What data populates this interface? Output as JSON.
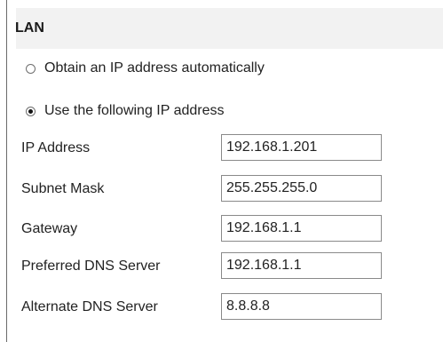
{
  "section": {
    "title": "LAN"
  },
  "ip_mode": {
    "options": [
      {
        "label": "Obtain an IP address automatically",
        "selected": false
      },
      {
        "label": "Use the following IP address",
        "selected": true
      }
    ]
  },
  "fields": {
    "ip_address": {
      "label": "IP Address",
      "value": "192.168.1.201"
    },
    "subnet_mask": {
      "label": "Subnet Mask",
      "value": "255.255.255.0"
    },
    "gateway": {
      "label": "Gateway",
      "value": "192.168.1.1"
    },
    "preferred_dns": {
      "label": "Preferred DNS Server",
      "value": "192.168.1.1"
    },
    "alternate_dns": {
      "label": "Alternate DNS Server",
      "value": "8.8.8.8"
    }
  }
}
